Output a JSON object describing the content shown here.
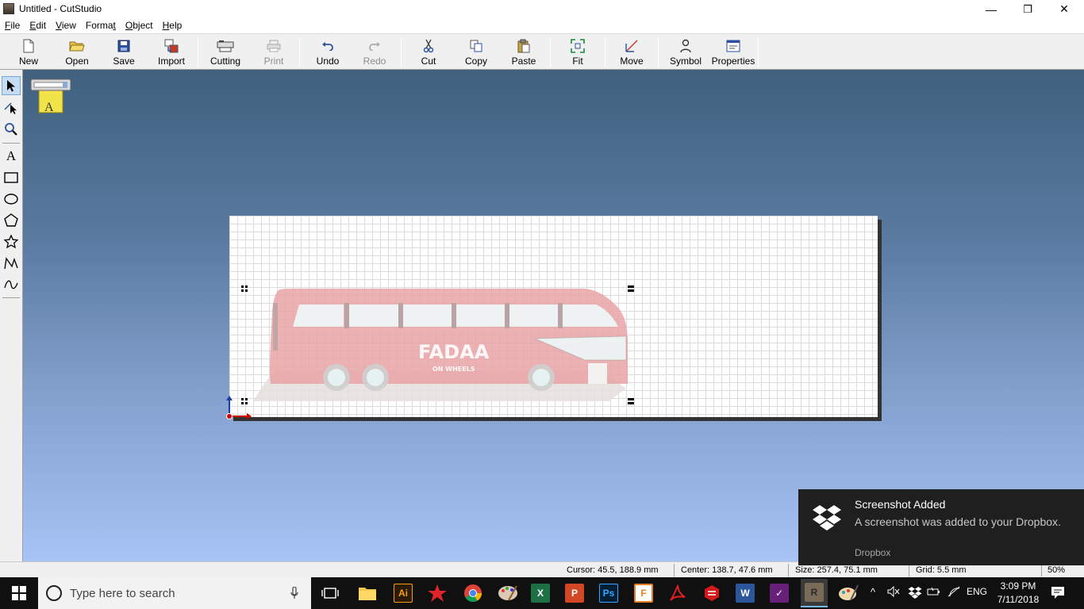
{
  "window": {
    "title": "Untitled - CutStudio",
    "minimize": "—",
    "restore": "❐",
    "close": "✕"
  },
  "menu": {
    "items": [
      {
        "label": "File",
        "mnemonic": "F",
        "rest": "ile"
      },
      {
        "label": "Edit",
        "mnemonic": "E",
        "rest": "dit"
      },
      {
        "label": "View",
        "mnemonic": "V",
        "rest": "iew"
      },
      {
        "label": "Format",
        "prefix": "Forma",
        "mnemonic": "t",
        "rest": ""
      },
      {
        "label": "Object",
        "mnemonic": "O",
        "rest": "bject"
      },
      {
        "label": "Help",
        "mnemonic": "H",
        "rest": "elp"
      }
    ]
  },
  "toolbar": {
    "new": "New",
    "open": "Open",
    "save": "Save",
    "import": "Import",
    "cutting": "Cutting",
    "print": "Print",
    "undo": "Undo",
    "redo": "Redo",
    "cut": "Cut",
    "copy": "Copy",
    "paste": "Paste",
    "fit": "Fit",
    "move": "Move",
    "symbol": "Symbol",
    "properties": "Properties"
  },
  "tools": [
    "select-tool",
    "node-edit-tool",
    "zoom-tool",
    "text-tool",
    "rectangle-tool",
    "ellipse-tool",
    "polygon-tool",
    "star-tool",
    "polyline-tool",
    "curve-tool"
  ],
  "artwork": {
    "logo_text": "FADAA",
    "logo_subtext": "ON WHEELS",
    "body_color": "#e9a3a6"
  },
  "statusbar": {
    "cursor": "Cursor: 45.5, 188.9 mm",
    "center": "Center: 138.7, 47.6 mm",
    "size": "Size: 257.4, 75.1 mm",
    "grid": "Grid: 5.5 mm",
    "zoom": "50%"
  },
  "notification": {
    "title": "Screenshot Added",
    "body": "A screenshot was added to your Dropbox.",
    "source": "Dropbox"
  },
  "taskbar": {
    "search_placeholder": "Type here to search",
    "language": "ENG",
    "time": "3:09 PM",
    "date": "7/11/2018"
  }
}
